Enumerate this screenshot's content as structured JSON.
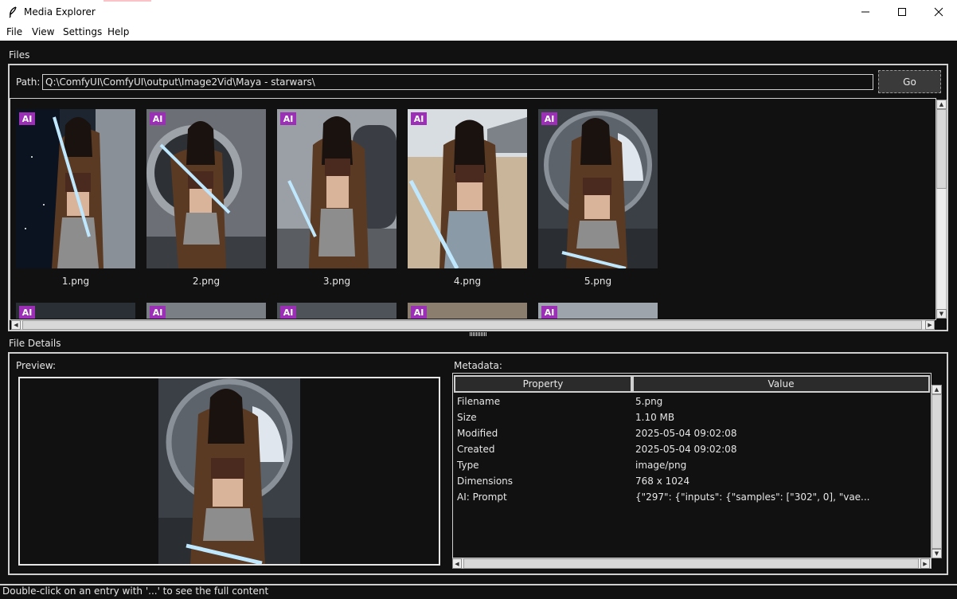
{
  "window": {
    "title": "Media Explorer",
    "minimize_icon": "minimize-icon",
    "maximize_icon": "maximize-icon",
    "close_icon": "close-icon"
  },
  "menu": [
    "File",
    "View",
    "Settings",
    "Help"
  ],
  "files_section": {
    "label": "Files",
    "path_label": "Path:",
    "path_value": "Q:\\ComfyUI\\ComfyUI\\output\\Image2Vid\\Maya - starwars\\",
    "go_label": "Go"
  },
  "thumbnails": [
    {
      "name": "1.png",
      "badge": "AI"
    },
    {
      "name": "2.png",
      "badge": "AI"
    },
    {
      "name": "3.png",
      "badge": "AI"
    },
    {
      "name": "4.png",
      "badge": "AI"
    },
    {
      "name": "5.png",
      "badge": "AI"
    }
  ],
  "thumbnails_row2": [
    {
      "badge": "AI"
    },
    {
      "badge": "AI"
    },
    {
      "badge": "AI"
    },
    {
      "badge": "AI"
    },
    {
      "badge": "AI"
    }
  ],
  "details": {
    "label": "File Details",
    "preview_label": "Preview:",
    "metadata_label": "Metadata:",
    "columns": [
      "Property",
      "Value"
    ],
    "rows": [
      {
        "property": "Filename",
        "value": "5.png"
      },
      {
        "property": "Size",
        "value": "1.10 MB"
      },
      {
        "property": "Modified",
        "value": "2025-05-04 09:02:08"
      },
      {
        "property": "Created",
        "value": "2025-05-04 09:02:08"
      },
      {
        "property": "Type",
        "value": "image/png"
      },
      {
        "property": "Dimensions",
        "value": "768 x 1024"
      },
      {
        "property": "AI: Prompt",
        "value": "{\"297\": {\"inputs\": {\"samples\": [\"302\", 0], \"vae..."
      }
    ]
  },
  "status": {
    "text": "Double-click on an entry with '...' to see the full content"
  },
  "colors": {
    "background": "#111111",
    "ai_badge": "#9b2fb5",
    "frame_border": "#cfcfcf"
  }
}
